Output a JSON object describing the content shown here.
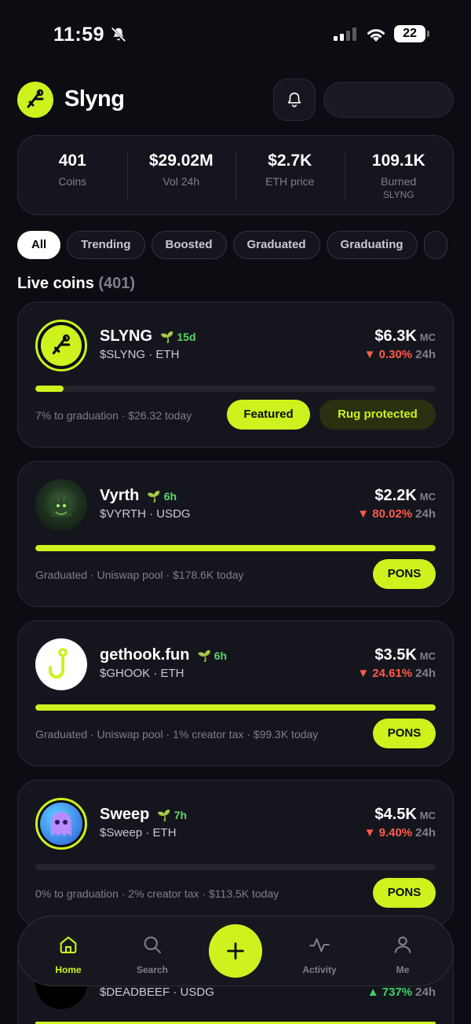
{
  "status": {
    "time": "11:59",
    "battery": "22"
  },
  "header": {
    "brand": "Slyng"
  },
  "stats": [
    {
      "value": "401",
      "label": "Coins"
    },
    {
      "value": "$29.02M",
      "label": "Vol 24h"
    },
    {
      "value": "$2.7K",
      "label": "ETH price"
    },
    {
      "value": "109.1K",
      "label": "Burned",
      "sub": "SLYNG"
    }
  ],
  "filters": [
    "All",
    "Trending",
    "Boosted",
    "Graduated",
    "Graduating"
  ],
  "section": {
    "title": "Live coins",
    "count": "(401)"
  },
  "coins": [
    {
      "name": "SLYNG",
      "age": "15d",
      "ticker": "$SLYNG · ETH",
      "mc": "$6.3K",
      "mc_unit": "MC",
      "change": "▼ 0.30%",
      "change_unit": "24h",
      "progress": 0.07,
      "meta": "7% to graduation · $26.32 today",
      "buttons": [
        "Featured",
        "Rug protected"
      ]
    },
    {
      "name": "Vyrth",
      "age": "6h",
      "ticker": "$VYRTH · USDG",
      "mc": "$2.2K",
      "mc_unit": "MC",
      "change": "▼ 80.02%",
      "change_unit": "24h",
      "progress": 1.0,
      "meta": "Graduated · Uniswap pool · $178.6K today",
      "buttons": [
        "PONS"
      ]
    },
    {
      "name": "gethook.fun",
      "age": "6h",
      "ticker": "$GHOOK · ETH",
      "mc": "$3.5K",
      "mc_unit": "MC",
      "change": "▼ 24.61%",
      "change_unit": "24h",
      "progress": 1.0,
      "meta": "Graduated · Uniswap pool · 1% creator tax · $99.3K today",
      "buttons": [
        "PONS"
      ]
    },
    {
      "name": "Sweep",
      "age": "7h",
      "ticker": "$Sweep · ETH",
      "mc": "$4.5K",
      "mc_unit": "MC",
      "change": "▼ 9.40%",
      "change_unit": "24h",
      "progress": 0.0,
      "meta": "0% to graduation · 2% creator tax · $113.5K today",
      "buttons": [
        "PONS"
      ]
    },
    {
      "ticker": "$DEADBEEF · USDG",
      "change": "▲ 737%",
      "change_unit": "24h"
    }
  ],
  "nav": [
    {
      "label": "Home",
      "icon": "home-icon"
    },
    {
      "label": "Search",
      "icon": "search-icon"
    },
    {
      "label": "Activity",
      "icon": "activity-icon"
    },
    {
      "label": "Me",
      "icon": "user-icon"
    }
  ],
  "colors": {
    "accent": "#cdf21e",
    "negative": "#ff5a4a",
    "positive": "#3fd36c",
    "bg": "#0c0d12"
  }
}
